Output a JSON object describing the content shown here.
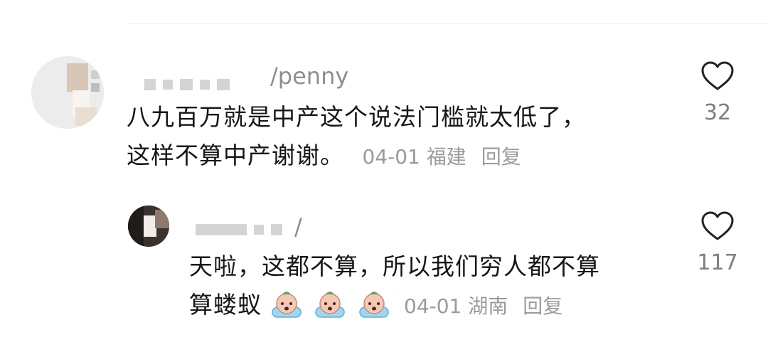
{
  "comments": [
    {
      "username_visible": "/penny",
      "text_line1": "八九百万就是中产这个说法门槛就太低了，",
      "text_line2": "这样不算中产谢谢。",
      "date": "04-01",
      "location": "福建",
      "reply_label": "回复",
      "like_count": "32",
      "avatar_icon": "user-avatar-photo",
      "like_icon": "heart-outline-icon"
    },
    {
      "username_visible": "/",
      "text_line1": "天啦，这都不算，所以我们穷人都不算",
      "text_line2": "算蝼蚁",
      "date": "04-01",
      "location": "湖南",
      "reply_label": "回复",
      "like_count": "117",
      "avatar_icon": "user-avatar-photo",
      "like_icon": "heart-outline-icon",
      "emoji_icons": [
        "crying-face-emoji",
        "crying-face-emoji",
        "crying-face-emoji"
      ]
    }
  ],
  "colors": {
    "text": "#161616",
    "meta": "#9a9a9a",
    "count": "#7f7f7f",
    "heart": "#222222"
  }
}
